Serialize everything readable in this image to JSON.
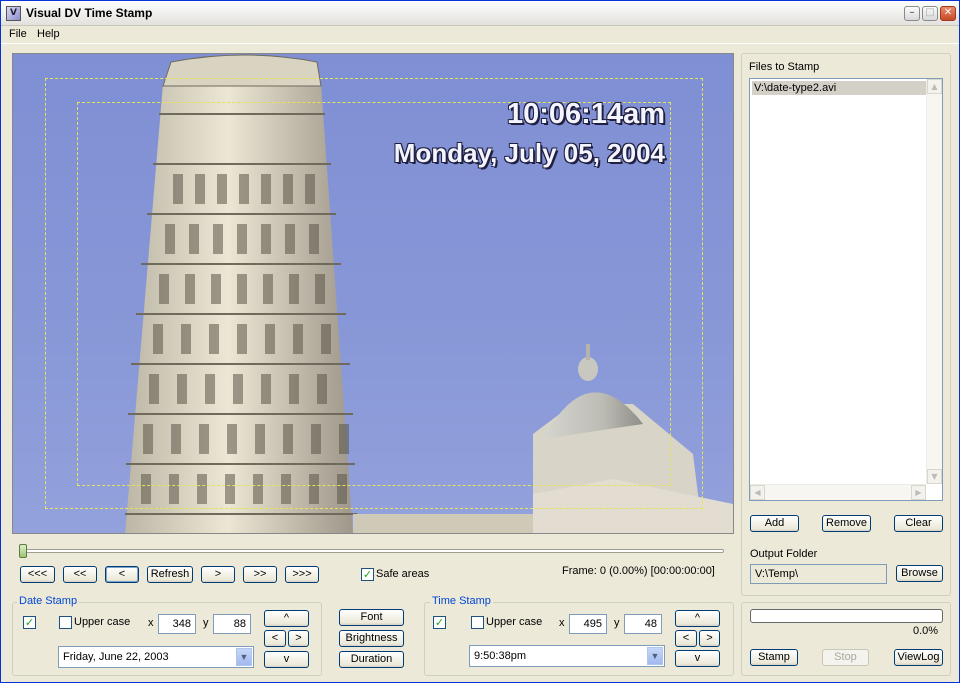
{
  "window": {
    "title": "Visual DV Time Stamp"
  },
  "menu": [
    "File",
    "Help"
  ],
  "preview": {
    "overlay_time": "10:06:14am",
    "overlay_date": "Monday, July 05, 2004"
  },
  "transport": {
    "buttons": [
      "<<<",
      "<<",
      "<",
      "Refresh",
      ">",
      ">>",
      ">>>"
    ],
    "safe_areas_label": "Safe areas",
    "safe_areas_checked": true,
    "frame_info": "Frame: 0 (0.00%) [00:00:00:00]"
  },
  "date_stamp": {
    "title": "Date Stamp",
    "enabled": true,
    "upper_case_label": "Upper case",
    "x_label": "x",
    "x": "348",
    "y_label": "y",
    "y": "88",
    "format": "Friday, June 22, 2003",
    "nudge": {
      "up": "^",
      "left": "<",
      "right": ">",
      "down": "v"
    }
  },
  "style_buttons": [
    "Font",
    "Brightness",
    "Duration"
  ],
  "time_stamp": {
    "title": "Time Stamp",
    "enabled": true,
    "upper_case_label": "Upper case",
    "x_label": "x",
    "x": "495",
    "y_label": "y",
    "y": "48",
    "format": "9:50:38pm",
    "nudge": {
      "up": "^",
      "left": "<",
      "right": ">",
      "down": "v"
    }
  },
  "files": {
    "label": "Files to Stamp",
    "items": [
      "V:\\date-type2.avi"
    ],
    "add": "Add",
    "remove": "Remove",
    "clear": "Clear"
  },
  "output": {
    "label": "Output Folder",
    "path": "V:\\Temp\\",
    "browse": "Browse"
  },
  "progress": {
    "value": 0,
    "text": "0.0%"
  },
  "actions": {
    "stamp": "Stamp",
    "stop": "Stop",
    "viewlog": "ViewLog"
  },
  "colors": {
    "title_blue": "#0046d5",
    "sky": "#8696d6",
    "safe_area": "#e6e25a"
  }
}
